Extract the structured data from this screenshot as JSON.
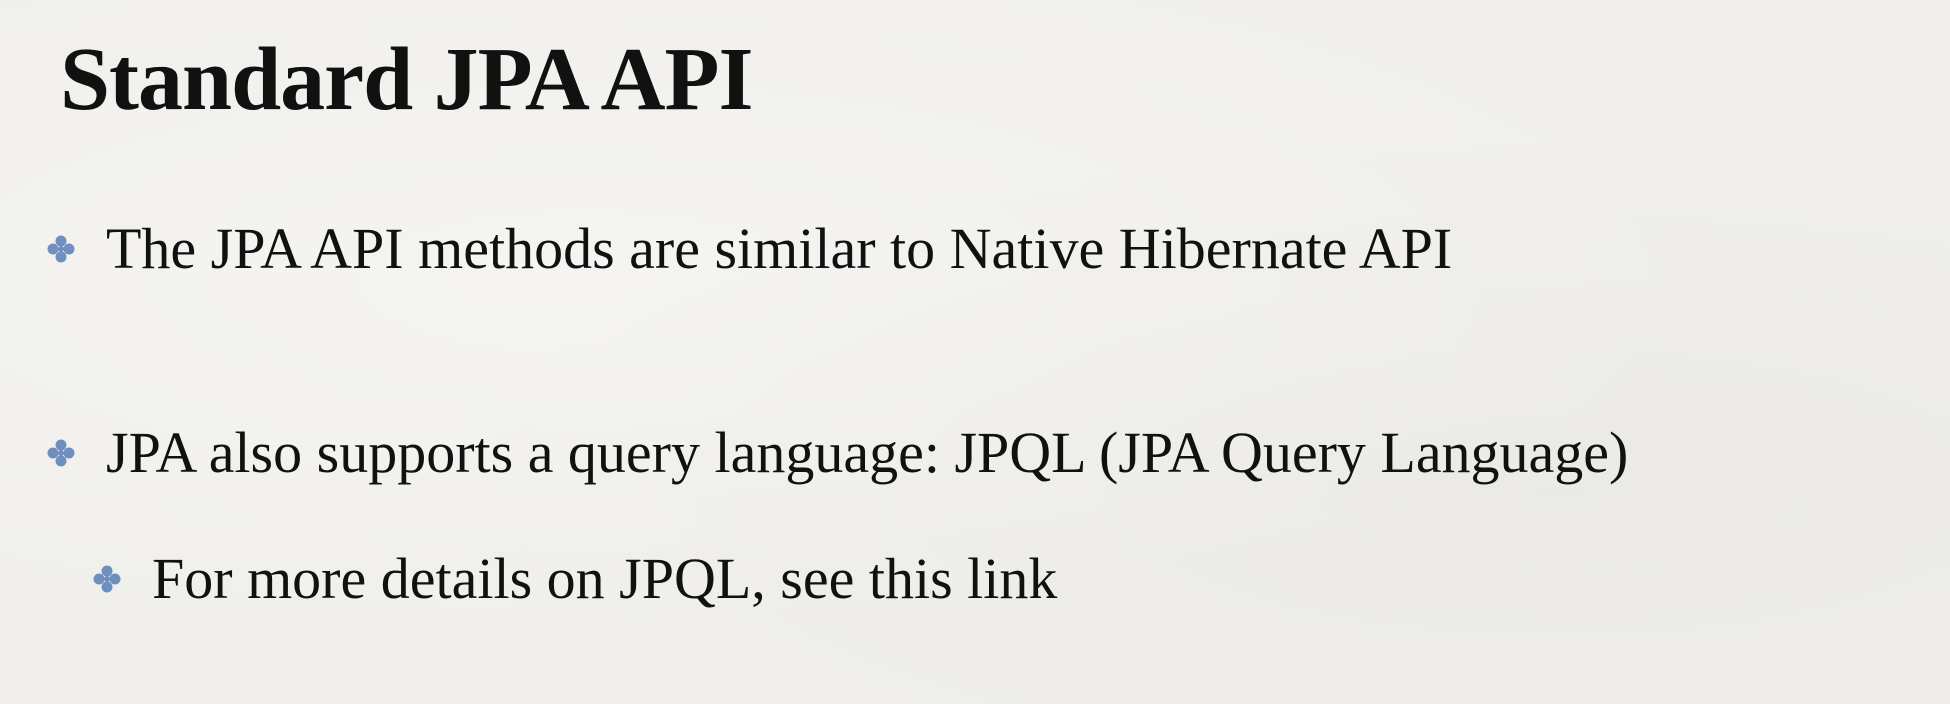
{
  "slide": {
    "title": "Standard JPA API",
    "bullets": [
      {
        "text": "The JPA API methods are similar to Native Hibernate API",
        "level": 1,
        "icon": "clover-bullet-icon"
      },
      {
        "text": "JPA also supports a query language: JPQL  (JPA Query Language)",
        "level": 1,
        "icon": "clover-bullet-icon"
      },
      {
        "text": "For more details on JPQL, see this link",
        "level": 2,
        "icon": "clover-bullet-icon"
      }
    ]
  },
  "colors": {
    "background": "#f0efeb",
    "text": "#111111",
    "bullet": "#6f8fbf"
  }
}
